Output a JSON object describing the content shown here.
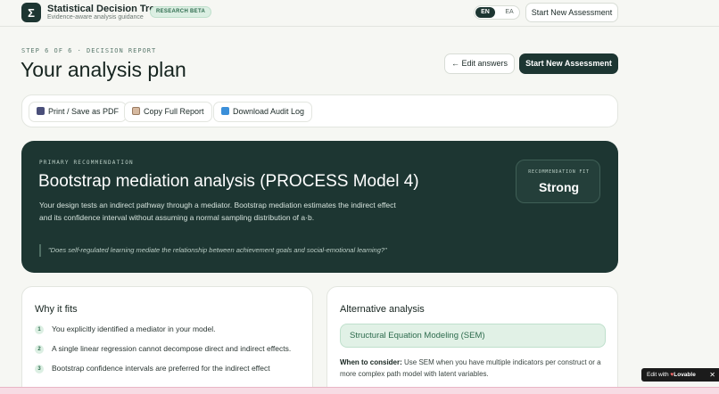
{
  "header": {
    "logo_glyph": "Σ",
    "title": "Statistical Decision Tree",
    "subtitle": "Evidence-aware analysis guidance",
    "badge": "RESEARCH BETA",
    "lang_active": "EN",
    "lang_other": "EA",
    "new_assessment": "Start New Assessment"
  },
  "page": {
    "step": "STEP 6 OF 6 · DECISION REPORT",
    "title": "Your analysis plan",
    "edit_answers": "← Edit answers",
    "new_assessment": "Start New Assessment"
  },
  "toolbar": {
    "print": "Print / Save as PDF",
    "copy": "Copy Full Report",
    "download": "Download Audit Log"
  },
  "recommendation": {
    "label": "PRIMARY RECOMMENDATION",
    "title": "Bootstrap mediation analysis (PROCESS Model 4)",
    "description": "Your design tests an indirect pathway through a mediator. Bootstrap mediation estimates the indirect effect and its confidence interval without assuming a normal sampling distribution of a·b.",
    "quote": "\"Does self-regulated learning mediate the relationship between achievement goals and social-emotional learning?\"",
    "fit_label": "RECOMMENDATION FIT",
    "fit_value": "Strong"
  },
  "why": {
    "title": "Why it fits",
    "items": [
      {
        "num": "1",
        "text": "You explicitly identified a mediator in your model."
      },
      {
        "num": "2",
        "text": "A single linear regression cannot decompose direct and indirect effects."
      },
      {
        "num": "3",
        "text": "Bootstrap confidence intervals are preferred for the indirect effect"
      }
    ]
  },
  "alternative": {
    "title": "Alternative analysis",
    "method": "Structural Equation Modeling (SEM)",
    "when_label": "When to consider:",
    "when_text": " Use SEM when you have multiple indicators per construct or a more complex path model with latent variables."
  },
  "badge": {
    "prefix": "Edit with",
    "heart": "♥",
    "brand": "Lovable",
    "close": "✕"
  },
  "colors": {
    "primary": "#1d3632",
    "accent_green": "#2d6b4d",
    "accent_bg": "#dcefe3",
    "background": "#f6f7f3"
  }
}
